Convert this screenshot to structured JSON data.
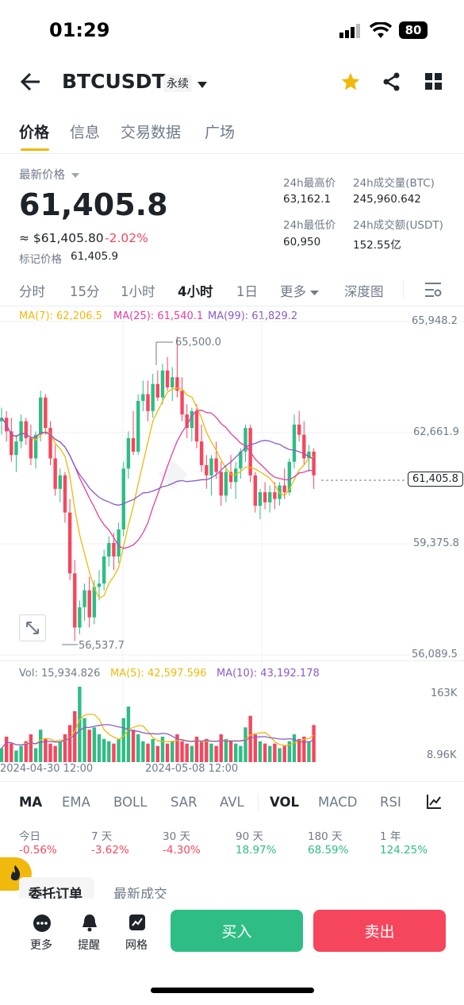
{
  "status_bar": {
    "time": "01:29",
    "battery": "80"
  },
  "header": {
    "symbol": "BTCUSDT",
    "contract_type": "永续"
  },
  "tabs": [
    "价格",
    "信息",
    "交易数据",
    "广场"
  ],
  "price": {
    "label": "最新价格",
    "last": "61,405.8",
    "usd_equiv": "≈ $61,405.80",
    "change": "-2.02%",
    "mark_label": "标记价格",
    "mark_value": "61,405.9"
  },
  "stats": {
    "high_label": "24h最高价",
    "high": "63,162.1",
    "vol_btc_label": "24h成交量(BTC)",
    "vol_btc": "245,960.642",
    "low_label": "24h最低价",
    "low": "60,950",
    "vol_usdt_label": "24h成交额(USDT)",
    "vol_usdt": "152.55亿"
  },
  "intervals": [
    "分时",
    "15分",
    "1小时",
    "4小时",
    "1日",
    "更多",
    "深度图"
  ],
  "active_interval": "4小时",
  "ma_legend": {
    "ma7": "MA(7): 62,206.5",
    "ma25": "MA(25): 61,540.1",
    "ma99": "MA(99): 61,829.2"
  },
  "price_axis": [
    "65,948.2",
    "62,661.9",
    "59,375.8",
    "56,089.5"
  ],
  "current_price_tag": "61,405.8",
  "annotations": {
    "high": "65,500.0",
    "low": "56,537.7"
  },
  "volume": {
    "vol": "Vol: 15,934.826",
    "ma5": "MA(5): 42,597.596",
    "ma10": "MA(10): 43,192.178",
    "axis_top": "163K",
    "axis_bottom": "8.96K"
  },
  "time_axis": [
    "2024-04-30 12:00",
    "2024-05-08 12:00"
  ],
  "indicators": [
    "MA",
    "EMA",
    "BOLL",
    "SAR",
    "AVL",
    "VOL",
    "MACD",
    "RSI"
  ],
  "performance": [
    {
      "label": "今日",
      "value": "-0.56%"
    },
    {
      "label": "7 天",
      "value": "-3.62%"
    },
    {
      "label": "30 天",
      "value": "-4.30%"
    },
    {
      "label": "90 天",
      "value": "18.97%"
    },
    {
      "label": "180 天",
      "value": "68.59%"
    },
    {
      "label": "1 年",
      "value": "124.25%"
    }
  ],
  "order_tabs": [
    "委托订单",
    "最新成交"
  ],
  "bottom_bar": {
    "more": "更多",
    "alert": "提醒",
    "grid": "网格",
    "buy": "买入",
    "sell": "卖出"
  },
  "colors": {
    "up": "#2ebd85",
    "down": "#f6465d",
    "accent": "#f0b90b",
    "ma7": "#f0b90b",
    "ma25": "#e040a0",
    "ma99": "#8a5cc8"
  },
  "chart_data": {
    "type": "candlestick",
    "candles": [
      [
        63000,
        63400,
        62600,
        63100
      ],
      [
        63100,
        63300,
        62400,
        62700
      ],
      [
        62700,
        63100,
        61800,
        62000
      ],
      [
        62000,
        62600,
        61500,
        62400
      ],
      [
        62400,
        63200,
        62200,
        63000
      ],
      [
        63000,
        63100,
        62300,
        62500
      ],
      [
        62500,
        62900,
        61700,
        61900
      ],
      [
        61900,
        62700,
        61600,
        62600
      ],
      [
        62600,
        63900,
        62400,
        63700
      ],
      [
        63700,
        63800,
        62600,
        62800
      ],
      [
        62800,
        63000,
        61700,
        61900
      ],
      [
        61900,
        62300,
        60800,
        61000
      ],
      [
        61000,
        61600,
        60600,
        61400
      ],
      [
        61400,
        61500,
        60000,
        60300
      ],
      [
        60300,
        60700,
        58300,
        58500
      ],
      [
        58500,
        58900,
        56500,
        56900
      ],
      [
        56900,
        57700,
        56700,
        57500
      ],
      [
        57500,
        58200,
        57100,
        58000
      ],
      [
        58000,
        58400,
        56900,
        57200
      ],
      [
        57200,
        58300,
        57000,
        58100
      ],
      [
        58100,
        58600,
        57700,
        58200
      ],
      [
        58200,
        59200,
        58000,
        59000
      ],
      [
        59000,
        59600,
        58700,
        59400
      ],
      [
        59400,
        59700,
        58600,
        59000
      ],
      [
        59000,
        60000,
        58800,
        59800
      ],
      [
        59800,
        61800,
        59600,
        61600
      ],
      [
        61600,
        62700,
        61300,
        62500
      ],
      [
        62500,
        63300,
        62000,
        62100
      ],
      [
        62100,
        63800,
        62000,
        63600
      ],
      [
        63600,
        64200,
        63300,
        63800
      ],
      [
        63800,
        64200,
        63000,
        63300
      ],
      [
        63300,
        64400,
        63100,
        64100
      ],
      [
        64100,
        64500,
        63600,
        63700
      ],
      [
        63700,
        64700,
        63500,
        64500
      ],
      [
        64500,
        64900,
        63900,
        64000
      ],
      [
        64000,
        64600,
        63600,
        64300
      ],
      [
        64300,
        65500,
        63700,
        63900
      ],
      [
        63900,
        64300,
        63000,
        63200
      ],
      [
        63200,
        63500,
        62500,
        62800
      ],
      [
        62800,
        63400,
        62400,
        63300
      ],
      [
        63300,
        63500,
        62200,
        62400
      ],
      [
        62400,
        62900,
        61500,
        61700
      ],
      [
        61700,
        62000,
        61000,
        61400
      ],
      [
        61400,
        62000,
        60800,
        61900
      ],
      [
        61900,
        62400,
        61300,
        61500
      ],
      [
        61500,
        61800,
        60500,
        60800
      ],
      [
        60800,
        61700,
        60600,
        61500
      ],
      [
        61500,
        62000,
        61000,
        61200
      ],
      [
        61200,
        61800,
        60700,
        61600
      ],
      [
        61600,
        62200,
        61300,
        62100
      ],
      [
        62100,
        62900,
        61800,
        62800
      ],
      [
        62800,
        62900,
        61200,
        61400
      ],
      [
        61400,
        61500,
        60300,
        60500
      ],
      [
        60500,
        61000,
        60100,
        60900
      ],
      [
        60900,
        61200,
        60400,
        60600
      ],
      [
        60600,
        61100,
        60300,
        60900
      ],
      [
        60900,
        61200,
        60400,
        60700
      ],
      [
        60700,
        61200,
        60500,
        61100
      ],
      [
        61100,
        61600,
        60700,
        60900
      ],
      [
        60900,
        61900,
        60800,
        61800
      ],
      [
        61800,
        63200,
        61600,
        62900
      ],
      [
        62900,
        63300,
        62400,
        62600
      ],
      [
        62600,
        63000,
        61700,
        61900
      ],
      [
        61900,
        62300,
        61500,
        62100
      ],
      [
        62100,
        62200,
        61000,
        61400
      ]
    ],
    "volumes": [
      30,
      55,
      40,
      25,
      35,
      45,
      60,
      30,
      70,
      50,
      40,
      35,
      45,
      60,
      80,
      110,
      163,
      95,
      70,
      75,
      60,
      50,
      45,
      40,
      50,
      95,
      120,
      70,
      60,
      45,
      40,
      50,
      35,
      55,
      40,
      45,
      60,
      45,
      40,
      35,
      55,
      45,
      50,
      40,
      35,
      60,
      50,
      45,
      40,
      35,
      75,
      100,
      60,
      45,
      40,
      35,
      40,
      30,
      35,
      45,
      60,
      50,
      55,
      45,
      80
    ]
  }
}
